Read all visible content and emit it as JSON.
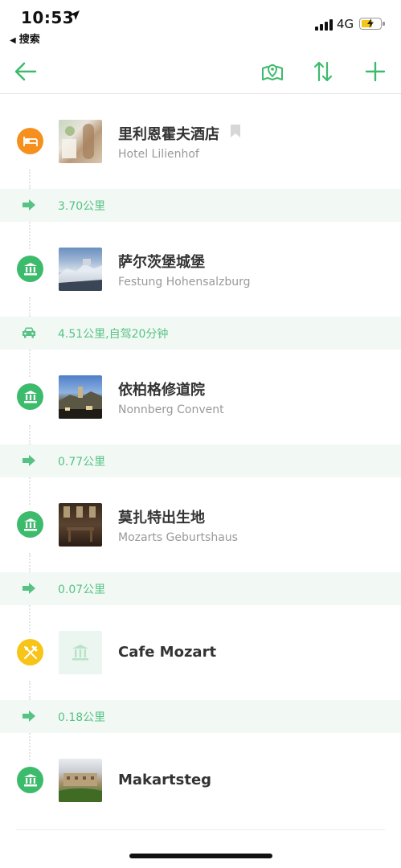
{
  "status_bar": {
    "time": "10:53",
    "back_app": "搜索",
    "network": "4G"
  },
  "nav": {
    "back_icon": "arrow-left-icon",
    "map_icon": "map-pin-icon",
    "sort_icon": "sort-arrows-icon",
    "add_icon": "plus-icon"
  },
  "colors": {
    "accent": "#3dbb6c",
    "hotel": "#f5901e",
    "food": "#f7c417",
    "segment_bg": "#f2f9f5",
    "segment_text": "#56c283"
  },
  "itinerary": [
    {
      "type": "poi",
      "category": "hotel",
      "icon": "bed-icon",
      "name": "里利恩霍夫酒店",
      "subtitle": "Hotel Lilienhof",
      "bookmark": true
    },
    {
      "type": "segment",
      "mode": "walk",
      "icon": "arrow-right-icon",
      "text": "3.70公里"
    },
    {
      "type": "poi",
      "category": "sight",
      "icon": "landmark-icon",
      "name": "萨尔茨堡城堡",
      "subtitle": "Festung Hohensalzburg"
    },
    {
      "type": "segment",
      "mode": "drive",
      "icon": "car-icon",
      "text": "4.51公里,自驾20分钟"
    },
    {
      "type": "poi",
      "category": "sight",
      "icon": "landmark-icon",
      "name": "依柏格修道院",
      "subtitle": "Nonnberg Convent"
    },
    {
      "type": "segment",
      "mode": "walk",
      "icon": "arrow-right-icon",
      "text": "0.77公里"
    },
    {
      "type": "poi",
      "category": "sight",
      "icon": "landmark-icon",
      "name": "莫扎特出生地",
      "subtitle": "Mozarts Geburtshaus"
    },
    {
      "type": "segment",
      "mode": "walk",
      "icon": "arrow-right-icon",
      "text": "0.07公里"
    },
    {
      "type": "poi",
      "category": "food",
      "icon": "fork-knife-icon",
      "name": "Cafe Mozart",
      "subtitle": ""
    },
    {
      "type": "segment",
      "mode": "walk",
      "icon": "arrow-right-icon",
      "text": "0.18公里"
    },
    {
      "type": "poi",
      "category": "sight",
      "icon": "landmark-icon",
      "name": "Makartsteg",
      "subtitle": ""
    }
  ]
}
